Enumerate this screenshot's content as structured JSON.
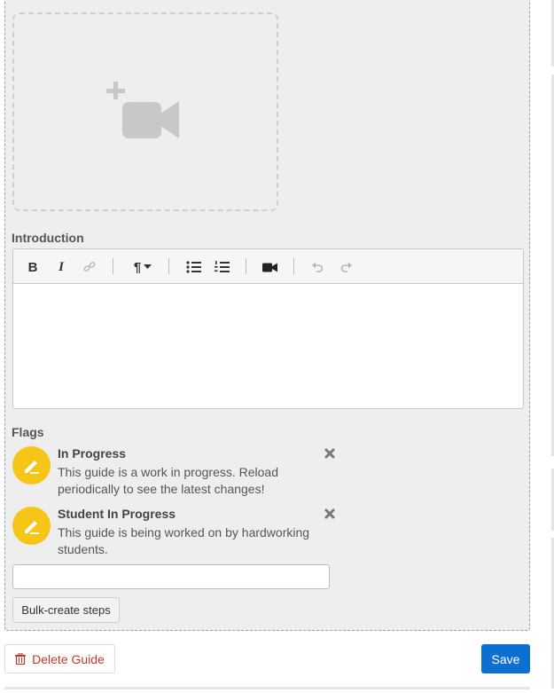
{
  "introduction": {
    "label": "Introduction"
  },
  "toolbar": {
    "bold": "B",
    "italic": "I",
    "paragraph": "¶"
  },
  "flags": {
    "label": "Flags",
    "items": [
      {
        "title": "In Progress",
        "description": "This guide is a work in progress. Reload periodically to see the latest changes!"
      },
      {
        "title": "Student In Progress",
        "description": "This guide is being worked on by hardworking students."
      }
    ],
    "input_value": ""
  },
  "actions": {
    "bulk_create": "Bulk-create steps",
    "delete": "Delete Guide",
    "save": "Save"
  },
  "colors": {
    "badge": "#f5c518",
    "save": "#0d70d0",
    "delete_text": "#c0392b"
  }
}
